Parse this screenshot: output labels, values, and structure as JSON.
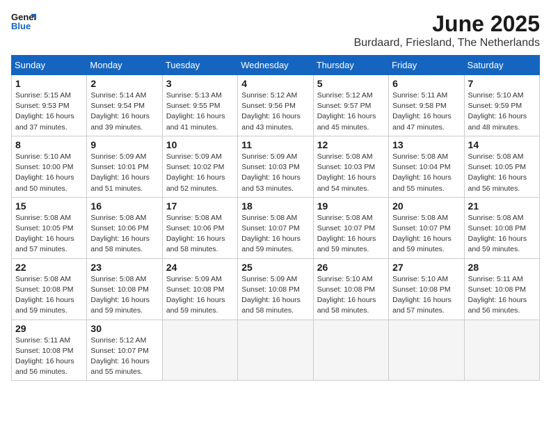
{
  "header": {
    "logo_line1": "General",
    "logo_line2": "Blue",
    "month_title": "June 2025",
    "location": "Burdaard, Friesland, The Netherlands"
  },
  "weekdays": [
    "Sunday",
    "Monday",
    "Tuesday",
    "Wednesday",
    "Thursday",
    "Friday",
    "Saturday"
  ],
  "weeks": [
    [
      {
        "day": "1",
        "info": "Sunrise: 5:15 AM\nSunset: 9:53 PM\nDaylight: 16 hours\nand 37 minutes."
      },
      {
        "day": "2",
        "info": "Sunrise: 5:14 AM\nSunset: 9:54 PM\nDaylight: 16 hours\nand 39 minutes."
      },
      {
        "day": "3",
        "info": "Sunrise: 5:13 AM\nSunset: 9:55 PM\nDaylight: 16 hours\nand 41 minutes."
      },
      {
        "day": "4",
        "info": "Sunrise: 5:12 AM\nSunset: 9:56 PM\nDaylight: 16 hours\nand 43 minutes."
      },
      {
        "day": "5",
        "info": "Sunrise: 5:12 AM\nSunset: 9:57 PM\nDaylight: 16 hours\nand 45 minutes."
      },
      {
        "day": "6",
        "info": "Sunrise: 5:11 AM\nSunset: 9:58 PM\nDaylight: 16 hours\nand 47 minutes."
      },
      {
        "day": "7",
        "info": "Sunrise: 5:10 AM\nSunset: 9:59 PM\nDaylight: 16 hours\nand 48 minutes."
      }
    ],
    [
      {
        "day": "8",
        "info": "Sunrise: 5:10 AM\nSunset: 10:00 PM\nDaylight: 16 hours\nand 50 minutes."
      },
      {
        "day": "9",
        "info": "Sunrise: 5:09 AM\nSunset: 10:01 PM\nDaylight: 16 hours\nand 51 minutes."
      },
      {
        "day": "10",
        "info": "Sunrise: 5:09 AM\nSunset: 10:02 PM\nDaylight: 16 hours\nand 52 minutes."
      },
      {
        "day": "11",
        "info": "Sunrise: 5:09 AM\nSunset: 10:03 PM\nDaylight: 16 hours\nand 53 minutes."
      },
      {
        "day": "12",
        "info": "Sunrise: 5:08 AM\nSunset: 10:03 PM\nDaylight: 16 hours\nand 54 minutes."
      },
      {
        "day": "13",
        "info": "Sunrise: 5:08 AM\nSunset: 10:04 PM\nDaylight: 16 hours\nand 55 minutes."
      },
      {
        "day": "14",
        "info": "Sunrise: 5:08 AM\nSunset: 10:05 PM\nDaylight: 16 hours\nand 56 minutes."
      }
    ],
    [
      {
        "day": "15",
        "info": "Sunrise: 5:08 AM\nSunset: 10:05 PM\nDaylight: 16 hours\nand 57 minutes."
      },
      {
        "day": "16",
        "info": "Sunrise: 5:08 AM\nSunset: 10:06 PM\nDaylight: 16 hours\nand 58 minutes."
      },
      {
        "day": "17",
        "info": "Sunrise: 5:08 AM\nSunset: 10:06 PM\nDaylight: 16 hours\nand 58 minutes."
      },
      {
        "day": "18",
        "info": "Sunrise: 5:08 AM\nSunset: 10:07 PM\nDaylight: 16 hours\nand 59 minutes."
      },
      {
        "day": "19",
        "info": "Sunrise: 5:08 AM\nSunset: 10:07 PM\nDaylight: 16 hours\nand 59 minutes."
      },
      {
        "day": "20",
        "info": "Sunrise: 5:08 AM\nSunset: 10:07 PM\nDaylight: 16 hours\nand 59 minutes."
      },
      {
        "day": "21",
        "info": "Sunrise: 5:08 AM\nSunset: 10:08 PM\nDaylight: 16 hours\nand 59 minutes."
      }
    ],
    [
      {
        "day": "22",
        "info": "Sunrise: 5:08 AM\nSunset: 10:08 PM\nDaylight: 16 hours\nand 59 minutes."
      },
      {
        "day": "23",
        "info": "Sunrise: 5:08 AM\nSunset: 10:08 PM\nDaylight: 16 hours\nand 59 minutes."
      },
      {
        "day": "24",
        "info": "Sunrise: 5:09 AM\nSunset: 10:08 PM\nDaylight: 16 hours\nand 59 minutes."
      },
      {
        "day": "25",
        "info": "Sunrise: 5:09 AM\nSunset: 10:08 PM\nDaylight: 16 hours\nand 58 minutes."
      },
      {
        "day": "26",
        "info": "Sunrise: 5:10 AM\nSunset: 10:08 PM\nDaylight: 16 hours\nand 58 minutes."
      },
      {
        "day": "27",
        "info": "Sunrise: 5:10 AM\nSunset: 10:08 PM\nDaylight: 16 hours\nand 57 minutes."
      },
      {
        "day": "28",
        "info": "Sunrise: 5:11 AM\nSunset: 10:08 PM\nDaylight: 16 hours\nand 56 minutes."
      }
    ],
    [
      {
        "day": "29",
        "info": "Sunrise: 5:11 AM\nSunset: 10:08 PM\nDaylight: 16 hours\nand 56 minutes."
      },
      {
        "day": "30",
        "info": "Sunrise: 5:12 AM\nSunset: 10:07 PM\nDaylight: 16 hours\nand 55 minutes."
      },
      {
        "day": "",
        "info": ""
      },
      {
        "day": "",
        "info": ""
      },
      {
        "day": "",
        "info": ""
      },
      {
        "day": "",
        "info": ""
      },
      {
        "day": "",
        "info": ""
      }
    ]
  ]
}
